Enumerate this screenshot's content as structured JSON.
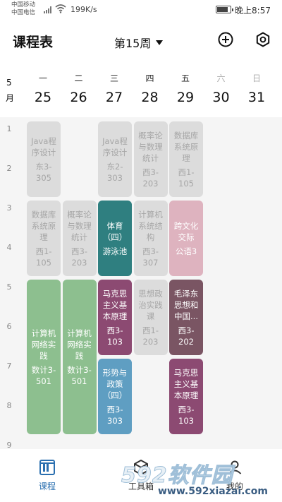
{
  "status_bar": {
    "carrier_1": "中国移动",
    "carrier_2": "中国电信",
    "net_speed": "199K/s",
    "time": "晚上8:57",
    "battery_level": 0.9
  },
  "header": {
    "title": "课程表",
    "week": "第15周"
  },
  "date_header": {
    "month_number": "5",
    "month_unit": "月",
    "days": [
      {
        "weekday": "一",
        "date": "25",
        "weekend": false
      },
      {
        "weekday": "二",
        "date": "26",
        "weekend": false
      },
      {
        "weekday": "三",
        "date": "27",
        "weekend": false
      },
      {
        "weekday": "四",
        "date": "28",
        "weekend": false
      },
      {
        "weekday": "五",
        "date": "29",
        "weekend": false
      },
      {
        "weekday": "六",
        "date": "30",
        "weekend": true
      },
      {
        "weekday": "日",
        "date": "31",
        "weekend": true
      }
    ]
  },
  "periods": [
    "1",
    "2",
    "3",
    "4",
    "5",
    "6",
    "7",
    "8",
    "9"
  ],
  "courses": [
    {
      "day": 1,
      "start": 1,
      "span": 2,
      "name": "Java程序设计",
      "room": "东3-305",
      "active": false,
      "color": "#dcdcdc"
    },
    {
      "day": 3,
      "start": 1,
      "span": 2,
      "name": "Java程序设计",
      "room": "东2-303",
      "active": false,
      "color": "#dcdcdc"
    },
    {
      "day": 4,
      "start": 1,
      "span": 2,
      "name": "概率论与数理统计",
      "room": "西3-203",
      "active": false,
      "color": "#dcdcdc"
    },
    {
      "day": 5,
      "start": 1,
      "span": 2,
      "name": "数据库系统原理",
      "room": "西1-105",
      "active": false,
      "color": "#dcdcdc"
    },
    {
      "day": 1,
      "start": 3,
      "span": 2,
      "name": "数据库系统原理",
      "room": "西1-105",
      "active": false,
      "color": "#dcdcdc"
    },
    {
      "day": 2,
      "start": 3,
      "span": 2,
      "name": "概率论与数理统计",
      "room": "西3-203",
      "active": false,
      "color": "#dcdcdc"
    },
    {
      "day": 3,
      "start": 3,
      "span": 2,
      "name": "体育（四）",
      "room": "游泳池",
      "active": true,
      "color": "#2f7f80"
    },
    {
      "day": 4,
      "start": 3,
      "span": 2,
      "name": "计算机系统结构",
      "room": "西3-307",
      "active": false,
      "color": "#dcdcdc"
    },
    {
      "day": 5,
      "start": 3,
      "span": 2,
      "name": "跨文化交际",
      "room": "公语3",
      "active": true,
      "color": "#deb3bf"
    },
    {
      "day": 1,
      "start": 5,
      "span": 4,
      "name": "计算机网络实践",
      "room": "数计3-501",
      "active": true,
      "color": "#8dbf8f"
    },
    {
      "day": 2,
      "start": 5,
      "span": 4,
      "name": "计算机网络实践",
      "room": "数计3-501",
      "active": true,
      "color": "#8dbf8f"
    },
    {
      "day": 3,
      "start": 5,
      "span": 2,
      "name": "马克思主义基本原理",
      "room": "西3-103",
      "active": true,
      "color": "#8c4a72"
    },
    {
      "day": 4,
      "start": 5,
      "span": 2,
      "name": "思想政治实践课",
      "room": "西1-203",
      "active": false,
      "color": "#dcdcdc"
    },
    {
      "day": 5,
      "start": 5,
      "span": 2,
      "name": "毛泽东思想和中国...",
      "room": "西3-202",
      "active": true,
      "color": "#7a5563"
    },
    {
      "day": 3,
      "start": 7,
      "span": 2,
      "name": "形势与政策（四）",
      "room": "西3-303",
      "active": true,
      "color": "#5f9ec2"
    },
    {
      "day": 5,
      "start": 7,
      "span": 2,
      "name": "马克思主义基本原理",
      "room": "西3-103",
      "active": true,
      "color": "#8c4a72"
    }
  ],
  "bottom_nav": {
    "items": [
      {
        "label": "课程",
        "selected": true
      },
      {
        "label": "工具箱",
        "selected": false
      },
      {
        "label": "我的",
        "selected": false
      }
    ]
  },
  "watermark": {
    "brand": "592软件园",
    "url": "www.592xiazai.com"
  },
  "colors": {
    "accent": "#2a6fb0",
    "grid_bg": "#f5f5f5",
    "inactive_course": "#dcdcdc"
  }
}
